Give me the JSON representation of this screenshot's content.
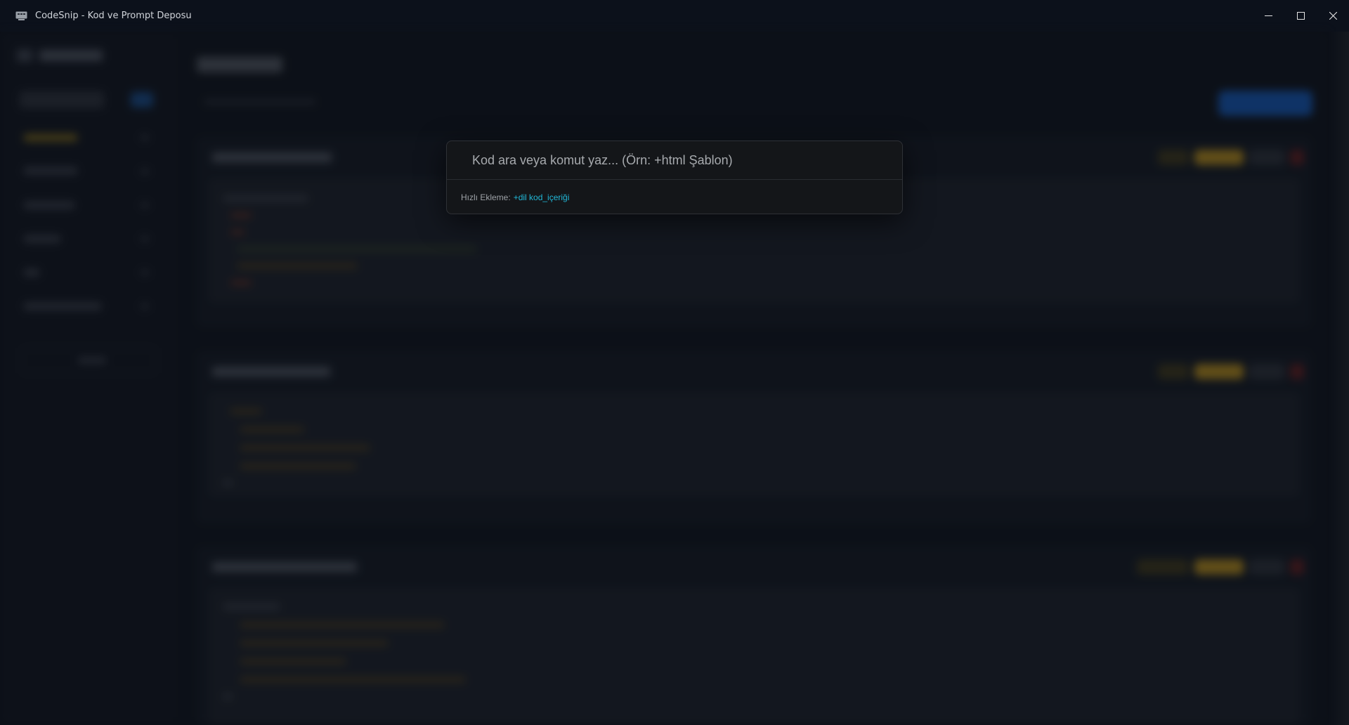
{
  "window": {
    "title": "CodeSnip - Kod ve Prompt Deposu",
    "icons": {
      "app": "app-icon",
      "minimize": "minimize-icon",
      "maximize": "maximize-icon",
      "close": "close-icon"
    }
  },
  "palette": {
    "placeholder": "Kod ara veya komut yaz... (Örn: +html Şablon)",
    "value": "",
    "hint_label": "Hızlı Ekleme:",
    "hint_syntax": "+dil kod_içeriği"
  },
  "colors": {
    "accent_blue": "#1452a8",
    "accent_gold": "#a8821a",
    "hint_cyan": "#22b8d8",
    "background": "#0b0f17"
  }
}
